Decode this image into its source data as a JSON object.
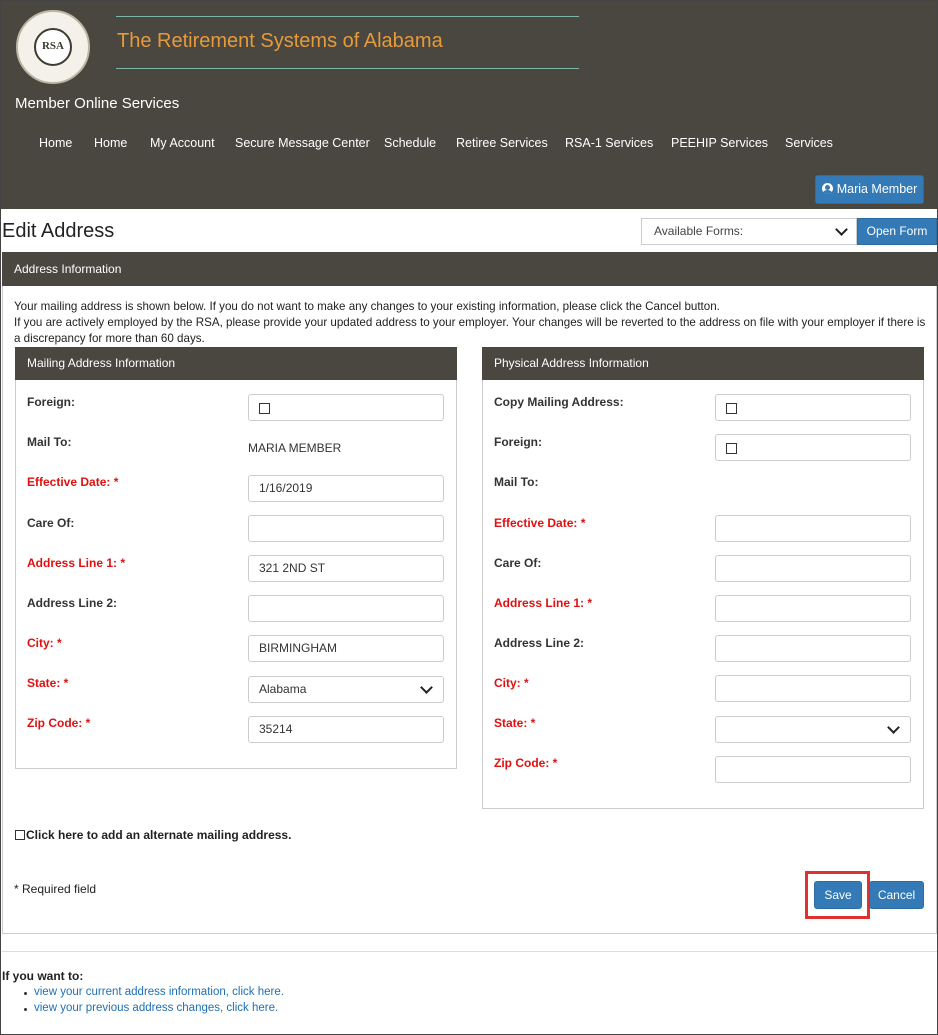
{
  "header": {
    "logo_text": "RSA",
    "site_title": "The Retirement Systems of Alabama",
    "subtitle": "Member Online Services",
    "nav": [
      "Home",
      "Home",
      "My Account",
      "Secure Message Center",
      "Schedule",
      "Retiree Services",
      "RSA-1 Services",
      "PEEHIP Services",
      "Services"
    ],
    "user_button": "Maria Member",
    "user_icon": "user-circle-icon"
  },
  "page": {
    "title": "Edit Address",
    "forms_select_value": "Available Forms:",
    "open_form_label": "Open Form"
  },
  "panel": {
    "title": "Address Information",
    "intro_line1": "Your mailing address is shown below. If you do not want to make any changes to your existing information, please click the Cancel button.",
    "intro_line2": "If you are actively employed by the RSA, please provide your updated address to your employer. Your changes will be reverted to the address on file with your employer if there is a discrepancy for more than 60 days."
  },
  "mailing": {
    "title": "Mailing Address Information",
    "labels": {
      "foreign": "Foreign:",
      "mail_to": "Mail To:",
      "effective_date": "Effective Date: *",
      "care_of": "Care Of:",
      "address1": "Address Line 1: *",
      "address2": "Address Line 2:",
      "city": "City: *",
      "state": "State: *",
      "zip": "Zip Code: *"
    },
    "values": {
      "mail_to": "MARIA MEMBER",
      "effective_date": "1/16/2019",
      "care_of": "",
      "address1": "321 2ND ST",
      "address2": "",
      "city": "BIRMINGHAM",
      "state": "Alabama",
      "zip": "35214"
    }
  },
  "physical": {
    "title": "Physical Address Information",
    "labels": {
      "copy_mailing": "Copy Mailing Address:",
      "foreign": "Foreign:",
      "mail_to": "Mail To:",
      "effective_date": "Effective Date: *",
      "care_of": "Care Of:",
      "address1": "Address Line 1: *",
      "address2": "Address Line 2:",
      "city": "City: *",
      "state": "State: *",
      "zip": "Zip Code: *"
    },
    "values": {
      "effective_date": "",
      "care_of": "",
      "address1": "",
      "address2": "",
      "city": "",
      "state": "",
      "zip": ""
    }
  },
  "alternate_label": "Click here to add an alternate mailing address.",
  "required_note": "* Required field",
  "buttons": {
    "save": "Save",
    "cancel": "Cancel"
  },
  "footer": {
    "title": "If you want to:",
    "links": [
      "view your current address information, click here.",
      "view your previous address changes, click here."
    ]
  },
  "colors": {
    "header_bg": "#4a4740",
    "title_orange": "#e59a3b",
    "primary_blue": "#337ab7",
    "required_red": "#e01010",
    "highlight_red": "#e03131"
  }
}
